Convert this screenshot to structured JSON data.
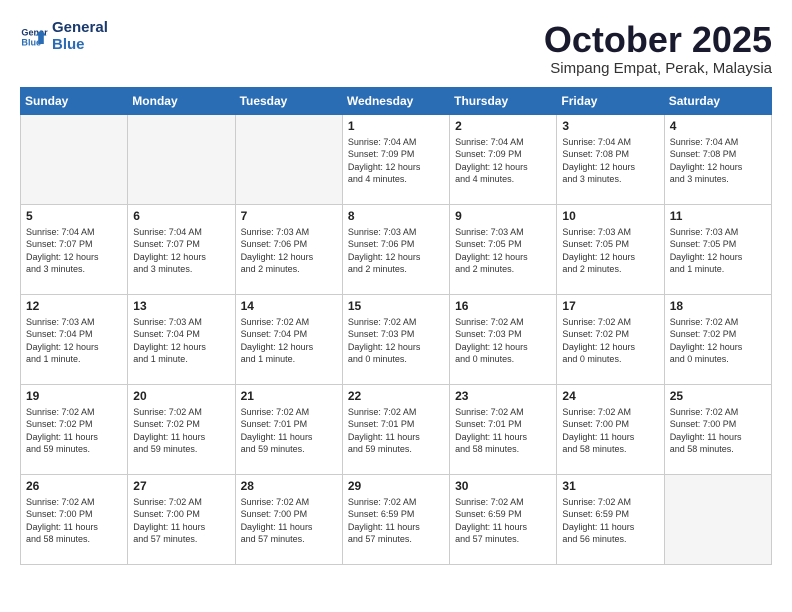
{
  "header": {
    "logo_line1": "General",
    "logo_line2": "Blue",
    "month_title": "October 2025",
    "subtitle": "Simpang Empat, Perak, Malaysia"
  },
  "weekdays": [
    "Sunday",
    "Monday",
    "Tuesday",
    "Wednesday",
    "Thursday",
    "Friday",
    "Saturday"
  ],
  "weeks": [
    [
      {
        "day": "",
        "info": ""
      },
      {
        "day": "",
        "info": ""
      },
      {
        "day": "",
        "info": ""
      },
      {
        "day": "1",
        "info": "Sunrise: 7:04 AM\nSunset: 7:09 PM\nDaylight: 12 hours\nand 4 minutes."
      },
      {
        "day": "2",
        "info": "Sunrise: 7:04 AM\nSunset: 7:09 PM\nDaylight: 12 hours\nand 4 minutes."
      },
      {
        "day": "3",
        "info": "Sunrise: 7:04 AM\nSunset: 7:08 PM\nDaylight: 12 hours\nand 3 minutes."
      },
      {
        "day": "4",
        "info": "Sunrise: 7:04 AM\nSunset: 7:08 PM\nDaylight: 12 hours\nand 3 minutes."
      }
    ],
    [
      {
        "day": "5",
        "info": "Sunrise: 7:04 AM\nSunset: 7:07 PM\nDaylight: 12 hours\nand 3 minutes."
      },
      {
        "day": "6",
        "info": "Sunrise: 7:04 AM\nSunset: 7:07 PM\nDaylight: 12 hours\nand 3 minutes."
      },
      {
        "day": "7",
        "info": "Sunrise: 7:03 AM\nSunset: 7:06 PM\nDaylight: 12 hours\nand 2 minutes."
      },
      {
        "day": "8",
        "info": "Sunrise: 7:03 AM\nSunset: 7:06 PM\nDaylight: 12 hours\nand 2 minutes."
      },
      {
        "day": "9",
        "info": "Sunrise: 7:03 AM\nSunset: 7:05 PM\nDaylight: 12 hours\nand 2 minutes."
      },
      {
        "day": "10",
        "info": "Sunrise: 7:03 AM\nSunset: 7:05 PM\nDaylight: 12 hours\nand 2 minutes."
      },
      {
        "day": "11",
        "info": "Sunrise: 7:03 AM\nSunset: 7:05 PM\nDaylight: 12 hours\nand 1 minute."
      }
    ],
    [
      {
        "day": "12",
        "info": "Sunrise: 7:03 AM\nSunset: 7:04 PM\nDaylight: 12 hours\nand 1 minute."
      },
      {
        "day": "13",
        "info": "Sunrise: 7:03 AM\nSunset: 7:04 PM\nDaylight: 12 hours\nand 1 minute."
      },
      {
        "day": "14",
        "info": "Sunrise: 7:02 AM\nSunset: 7:04 PM\nDaylight: 12 hours\nand 1 minute."
      },
      {
        "day": "15",
        "info": "Sunrise: 7:02 AM\nSunset: 7:03 PM\nDaylight: 12 hours\nand 0 minutes."
      },
      {
        "day": "16",
        "info": "Sunrise: 7:02 AM\nSunset: 7:03 PM\nDaylight: 12 hours\nand 0 minutes."
      },
      {
        "day": "17",
        "info": "Sunrise: 7:02 AM\nSunset: 7:02 PM\nDaylight: 12 hours\nand 0 minutes."
      },
      {
        "day": "18",
        "info": "Sunrise: 7:02 AM\nSunset: 7:02 PM\nDaylight: 12 hours\nand 0 minutes."
      }
    ],
    [
      {
        "day": "19",
        "info": "Sunrise: 7:02 AM\nSunset: 7:02 PM\nDaylight: 11 hours\nand 59 minutes."
      },
      {
        "day": "20",
        "info": "Sunrise: 7:02 AM\nSunset: 7:02 PM\nDaylight: 11 hours\nand 59 minutes."
      },
      {
        "day": "21",
        "info": "Sunrise: 7:02 AM\nSunset: 7:01 PM\nDaylight: 11 hours\nand 59 minutes."
      },
      {
        "day": "22",
        "info": "Sunrise: 7:02 AM\nSunset: 7:01 PM\nDaylight: 11 hours\nand 59 minutes."
      },
      {
        "day": "23",
        "info": "Sunrise: 7:02 AM\nSunset: 7:01 PM\nDaylight: 11 hours\nand 58 minutes."
      },
      {
        "day": "24",
        "info": "Sunrise: 7:02 AM\nSunset: 7:00 PM\nDaylight: 11 hours\nand 58 minutes."
      },
      {
        "day": "25",
        "info": "Sunrise: 7:02 AM\nSunset: 7:00 PM\nDaylight: 11 hours\nand 58 minutes."
      }
    ],
    [
      {
        "day": "26",
        "info": "Sunrise: 7:02 AM\nSunset: 7:00 PM\nDaylight: 11 hours\nand 58 minutes."
      },
      {
        "day": "27",
        "info": "Sunrise: 7:02 AM\nSunset: 7:00 PM\nDaylight: 11 hours\nand 57 minutes."
      },
      {
        "day": "28",
        "info": "Sunrise: 7:02 AM\nSunset: 7:00 PM\nDaylight: 11 hours\nand 57 minutes."
      },
      {
        "day": "29",
        "info": "Sunrise: 7:02 AM\nSunset: 6:59 PM\nDaylight: 11 hours\nand 57 minutes."
      },
      {
        "day": "30",
        "info": "Sunrise: 7:02 AM\nSunset: 6:59 PM\nDaylight: 11 hours\nand 57 minutes."
      },
      {
        "day": "31",
        "info": "Sunrise: 7:02 AM\nSunset: 6:59 PM\nDaylight: 11 hours\nand 56 minutes."
      },
      {
        "day": "",
        "info": ""
      }
    ]
  ]
}
